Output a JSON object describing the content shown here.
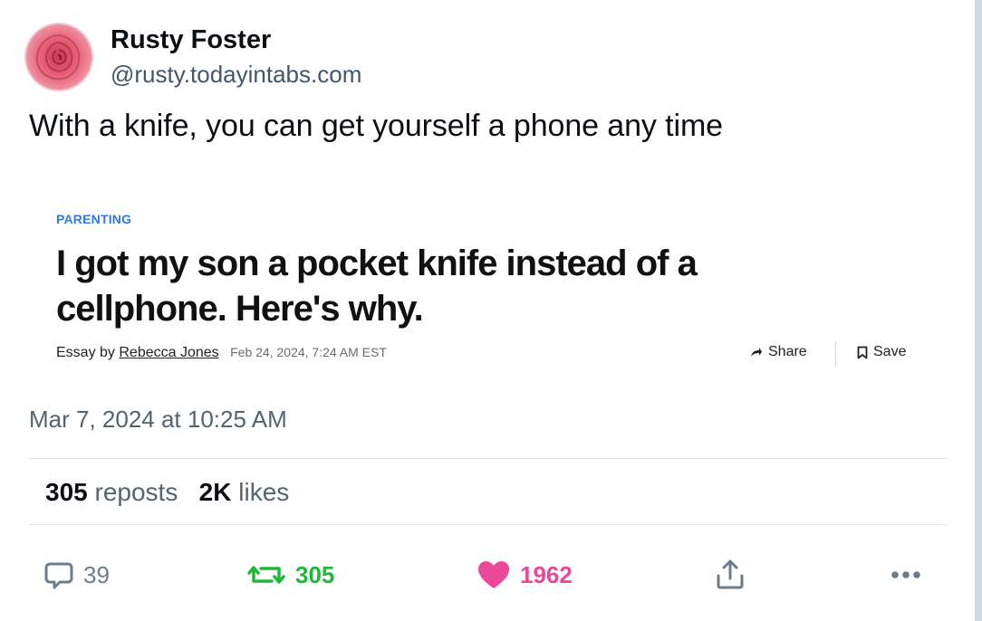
{
  "author": {
    "name": "Rusty Foster",
    "handle": "@rusty.todayintabs.com",
    "avatar": "rose-photo"
  },
  "post": {
    "text": "With a knife, you can get yourself a phone any time",
    "timestamp": "Mar 7, 2024 at 10:25 AM"
  },
  "embed": {
    "category": "PARENTING",
    "headline": "I got my son a pocket knife instead of a cellphone. Here's why.",
    "byline_prefix": "Essay by",
    "byline_author": "Rebecca Jones",
    "date": "Feb 24, 2024, 7:24 AM EST",
    "share_label": "Share",
    "save_label": "Save",
    "category_color": "#2f7bd9"
  },
  "stats": {
    "reposts_count": "305",
    "reposts_label": "reposts",
    "likes_count": "2K",
    "likes_label": "likes"
  },
  "actions": {
    "reply_count": "39",
    "repost_count": "305",
    "like_count": "1962",
    "reply_icon": "speech-bubble-icon",
    "repost_icon": "repost-arrows-icon",
    "like_icon": "heart-icon",
    "share_icon": "share-upload-icon",
    "more_icon": "ellipsis-icon",
    "repost_color": "#20b83a",
    "like_color": "#ec4899"
  }
}
